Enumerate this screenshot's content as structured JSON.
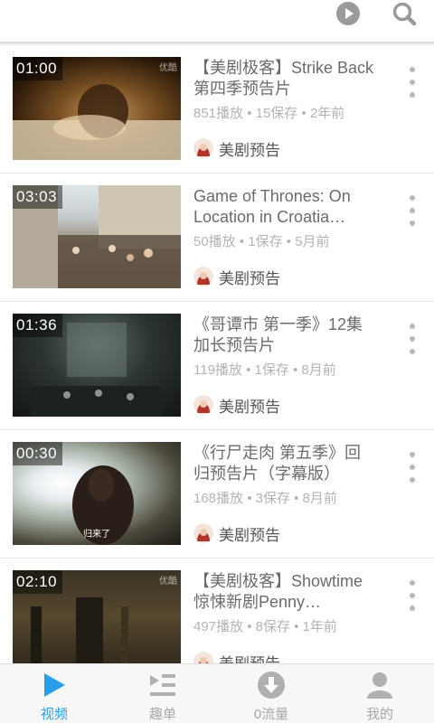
{
  "header": {
    "play_icon": "play-circle-icon",
    "search_icon": "search-icon"
  },
  "videos": [
    {
      "duration": "01:00",
      "watermark": "优酷",
      "title": "【美剧极客】Strike Back第四季预告片",
      "stats": "851播放 • 15保存 • 2年前",
      "channel": "美剧预告",
      "subtitle": ""
    },
    {
      "duration": "03:03",
      "watermark": "",
      "title": "Game of Thrones: On Location in Croatia…",
      "stats": "50播放 • 1保存 • 5月前",
      "channel": "美剧预告",
      "subtitle": ""
    },
    {
      "duration": "01:36",
      "watermark": "",
      "title": "《哥谭市 第一季》12集加长预告片",
      "stats": "119播放 • 1保存 • 8月前",
      "channel": "美剧预告",
      "subtitle": ""
    },
    {
      "duration": "00:30",
      "watermark": "",
      "title": "《行尸走肉 第五季》回归预告片（字幕版）",
      "stats": "168播放 • 3保存 • 8月前",
      "channel": "美剧预告",
      "subtitle": "归来了"
    },
    {
      "duration": "02:10",
      "watermark": "优酷",
      "title": "【美剧极客】Showtime惊悚新剧Penny Dreadful…",
      "stats": "497播放 • 8保存 • 1年前",
      "channel": "美剧预告",
      "subtitle": ""
    }
  ],
  "tabs": [
    {
      "label": "视频",
      "icon": "play-triangle-icon",
      "active": true
    },
    {
      "label": "趣单",
      "icon": "playlist-icon",
      "active": false
    },
    {
      "label": "0流量",
      "icon": "download-circle-icon",
      "active": false
    },
    {
      "label": "我的",
      "icon": "user-icon",
      "active": false
    }
  ],
  "colors": {
    "accent": "#2a9ee6",
    "icon_gray": "#9a9a9a",
    "title_text": "#6b6b6b",
    "meta_text": "#b3b3b3"
  }
}
